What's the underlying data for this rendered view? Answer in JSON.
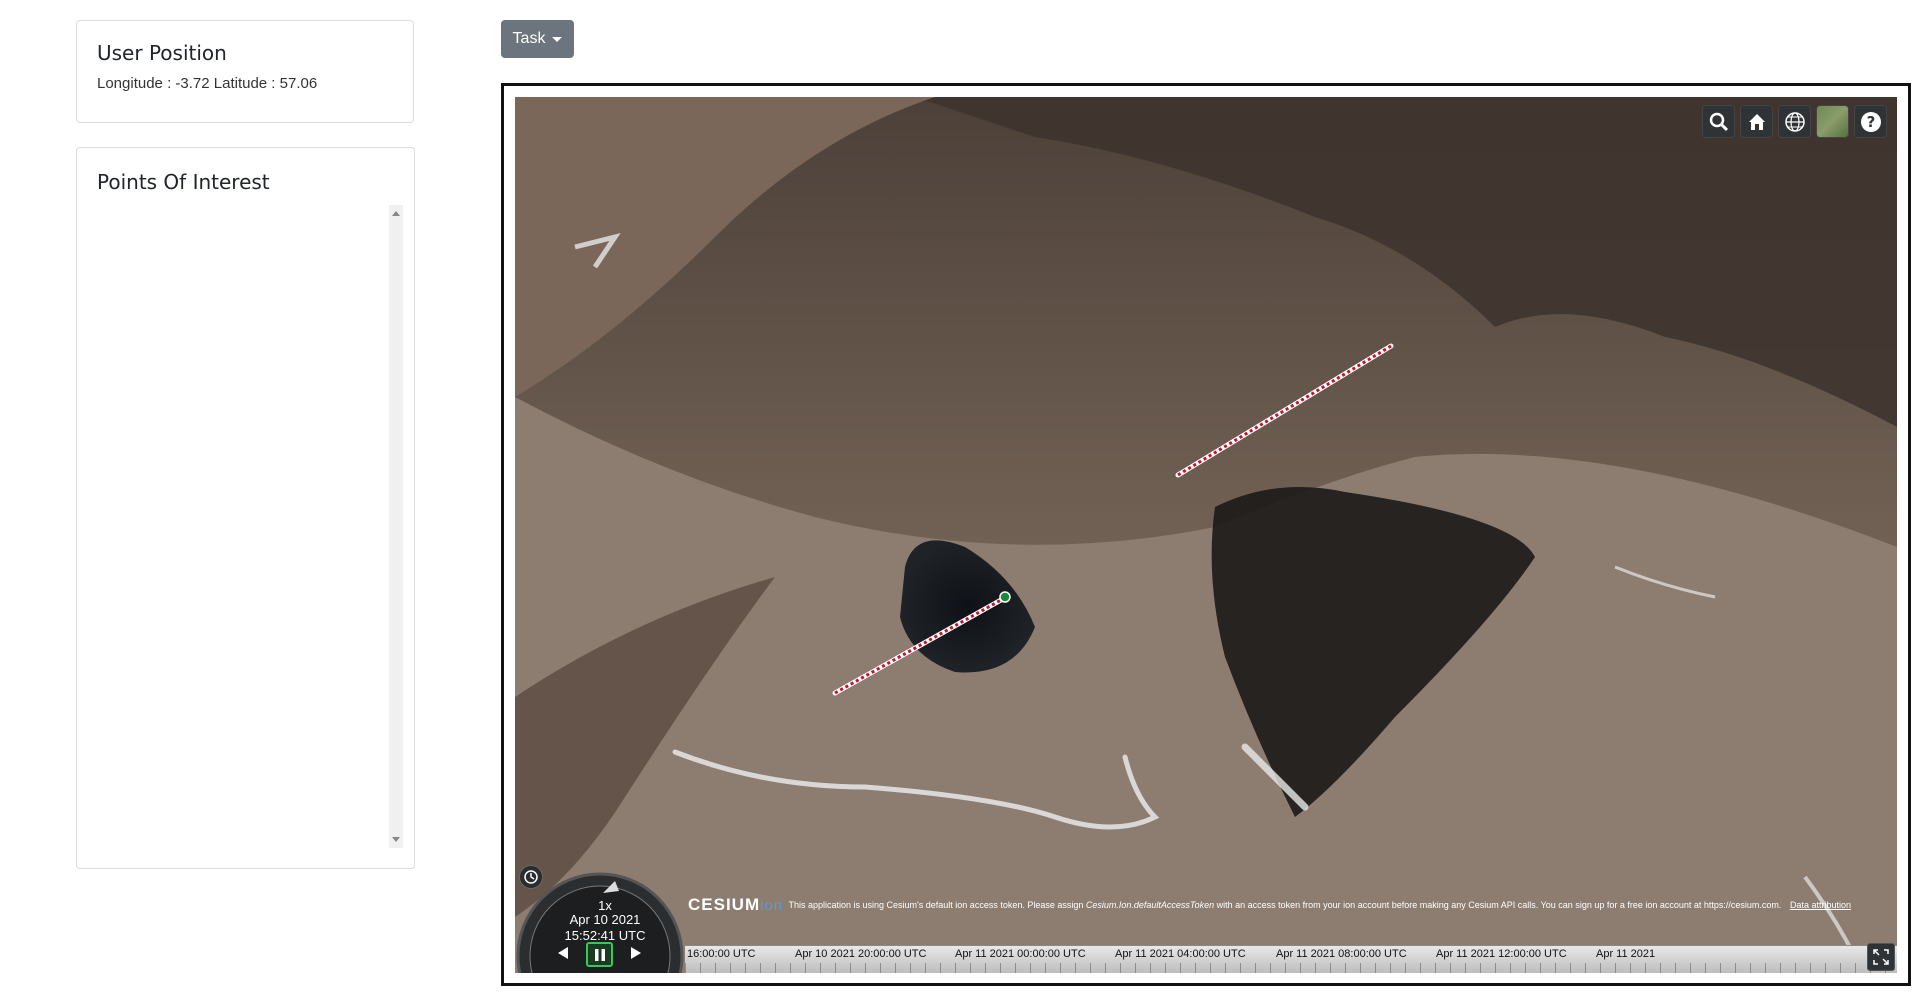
{
  "user_position": {
    "title": "User Position",
    "text": "Longitude : -3.72 Latitude : 57.06"
  },
  "points_of_interest": {
    "title": "Points Of Interest",
    "items": []
  },
  "task_button": {
    "label": "Task"
  },
  "viewer": {
    "toolbar": [
      "search-icon",
      "home-icon",
      "globe-icon",
      "imagery-layer-icon",
      "help-icon"
    ],
    "animation": {
      "speed": "1x",
      "date": "Apr 10 2021",
      "time": "15:52:41 UTC"
    },
    "credit": {
      "logo": "CESIUM",
      "logo_suffix": "ion",
      "message_pre": "This application is using Cesium's default ion access token. Please assign ",
      "message_token": "Cesium.Ion.defaultAccessToken",
      "message_post": " with an access token from your ion account before making any Cesium API calls. You can sign up for a free ion account at https://cesium.com.",
      "attribution_link": "Data attribution"
    },
    "timeline_ticks": [
      "16:00:00 UTC",
      "Apr 10 2021 20:00:00 UTC",
      "Apr 11 2021 00:00:00 UTC",
      "Apr 11 2021 04:00:00 UTC",
      "Apr 11 2021 08:00:00 UTC",
      "Apr 11 2021 12:00:00 UTC",
      "Apr 11 2021"
    ]
  },
  "colors": {
    "button_bg": "#6c757d",
    "path_red": "#c8102e",
    "terrain": "#6b5a4c"
  }
}
